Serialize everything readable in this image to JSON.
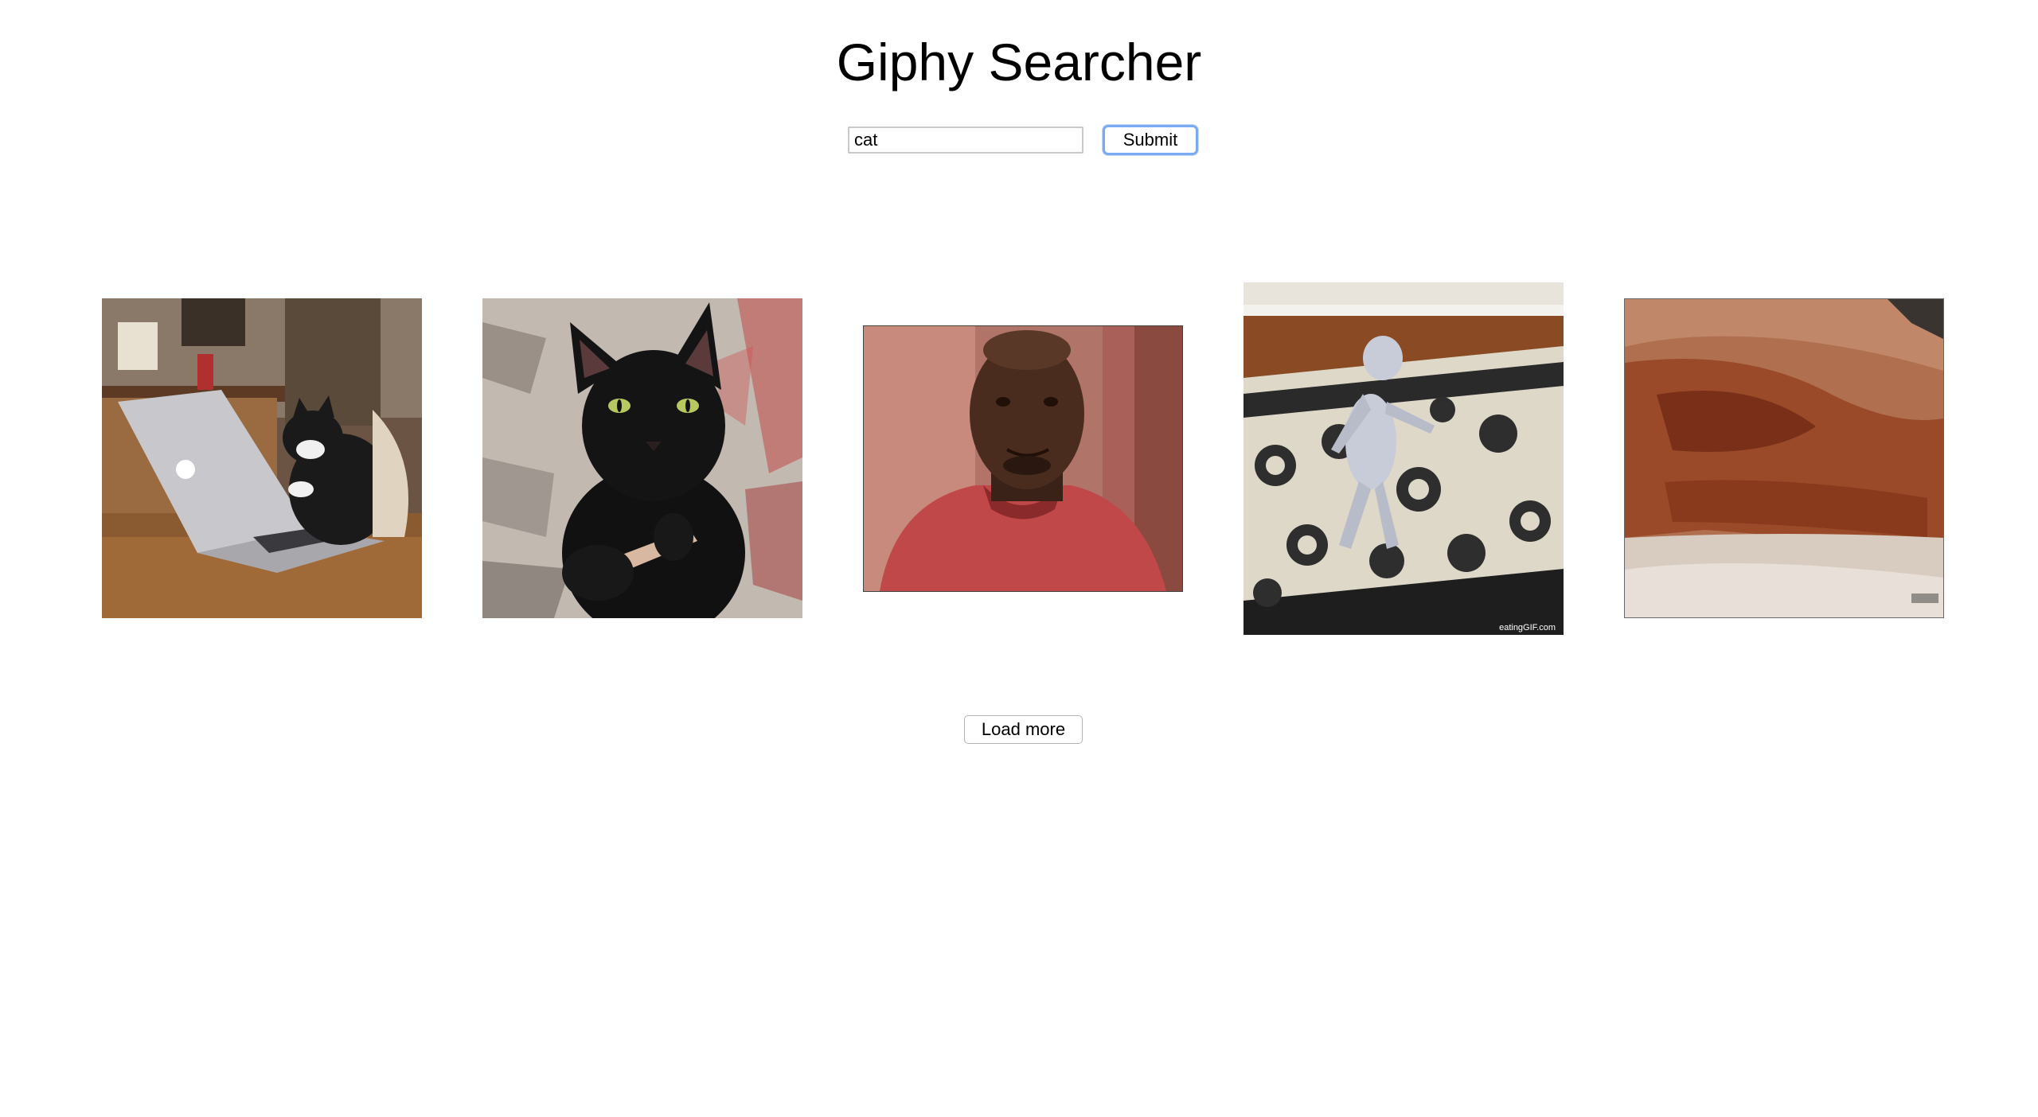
{
  "header": {
    "title": "Giphy Searcher"
  },
  "search": {
    "value": "cat",
    "submit_label": "Submit"
  },
  "results": {
    "watermark_4": "eatingGIF.com"
  },
  "footer": {
    "load_more_label": "Load more"
  },
  "colors": {
    "focus_ring": "#7aaaf0",
    "input_border": "#c9c9c9"
  }
}
